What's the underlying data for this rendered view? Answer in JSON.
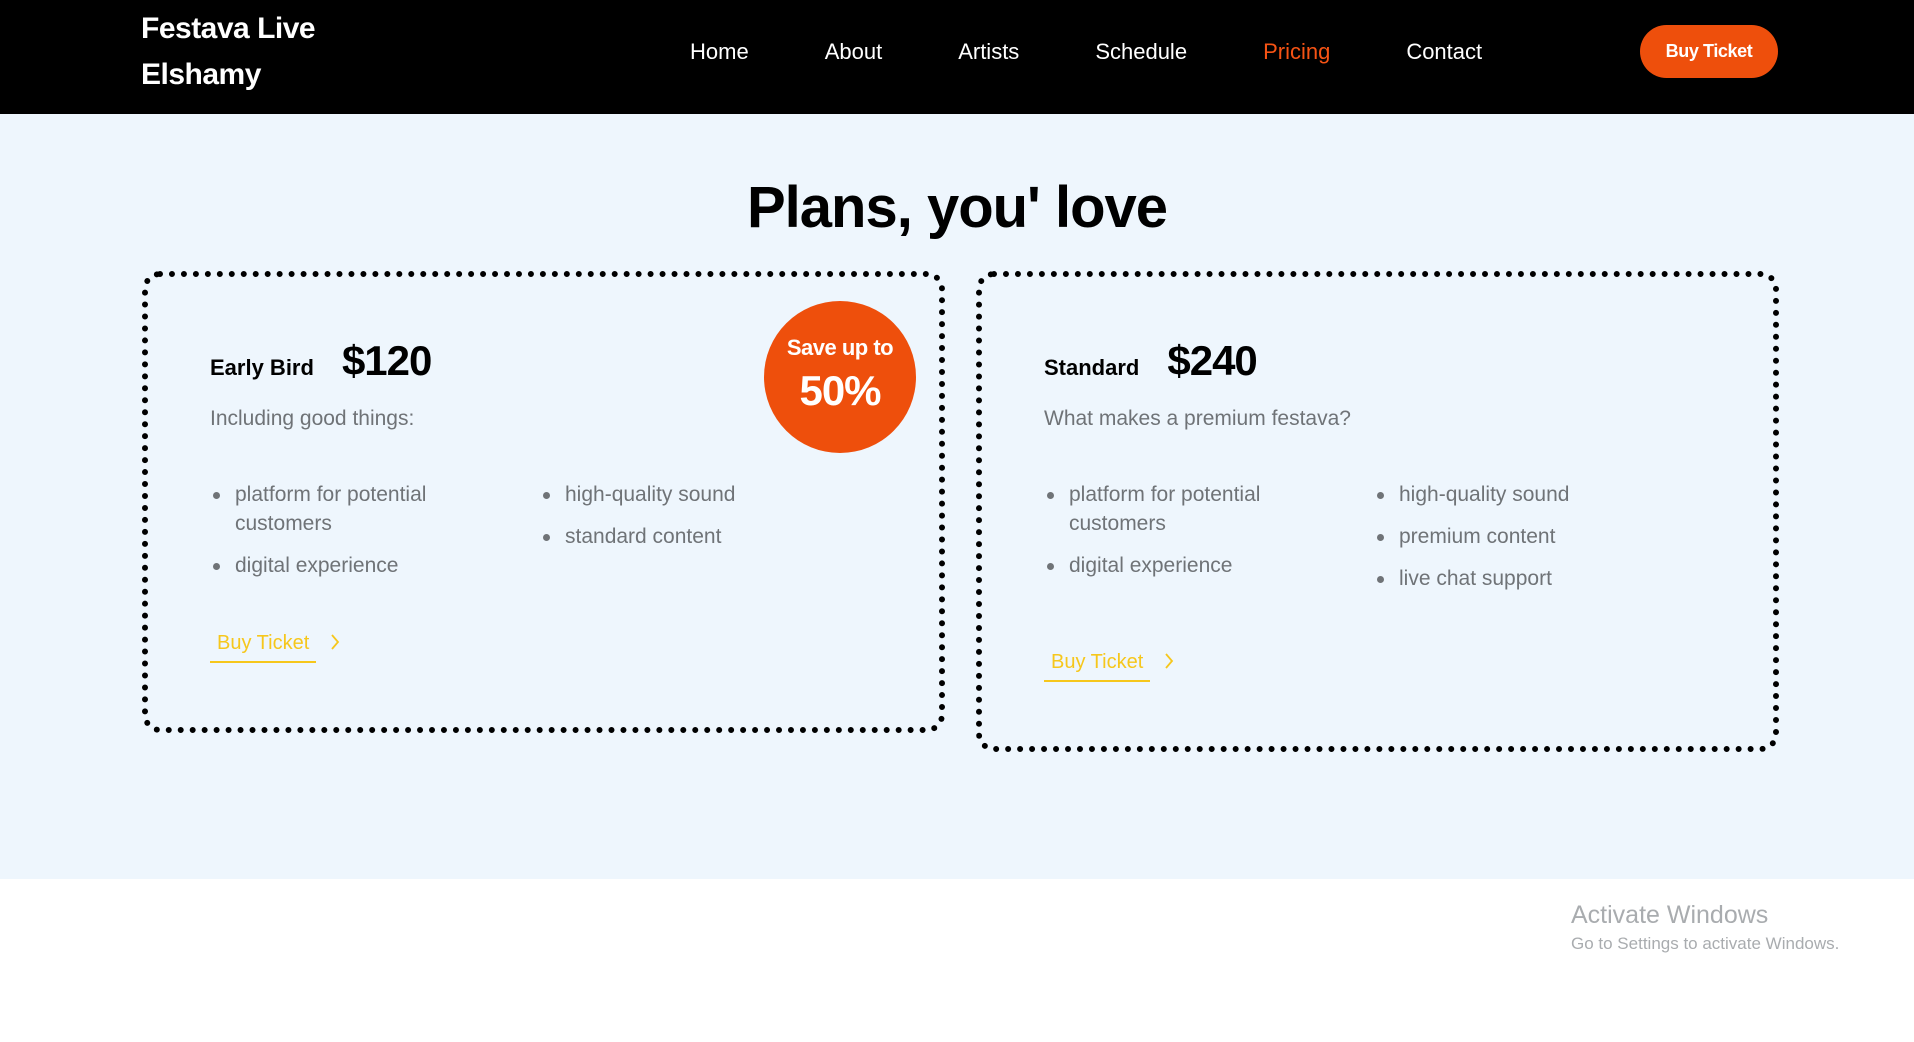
{
  "nav": {
    "brand_line1": "Festava Live",
    "brand_line2": "Elshamy",
    "links": [
      {
        "label": "Home"
      },
      {
        "label": "About"
      },
      {
        "label": "Artists"
      },
      {
        "label": "Schedule"
      },
      {
        "label": "Pricing",
        "active": true
      },
      {
        "label": "Contact"
      }
    ],
    "cta_label": "Buy Ticket"
  },
  "pricing": {
    "title": "Plans, you' love",
    "plans": [
      {
        "name": "Early Bird",
        "price": "$120",
        "subtitle": "Including good things:",
        "features_left": [
          "platform for potential customers",
          "digital experience"
        ],
        "features_right": [
          "high-quality sound",
          "standard content"
        ],
        "cta_label": "Buy Ticket",
        "badge": {
          "line1": "Save up to",
          "line2": "50%"
        }
      },
      {
        "name": "Standard",
        "price": "$240",
        "subtitle": "What makes a premium festava?",
        "features_left": [
          "platform for potential customers",
          "digital experience"
        ],
        "features_right": [
          "high-quality sound",
          "premium content",
          "live chat support"
        ],
        "cta_label": "Buy Ticket"
      }
    ]
  },
  "watermark": {
    "title": "Activate Windows",
    "subtitle": "Go to Settings to activate Windows."
  },
  "colors": {
    "accent": "#ee4f0c",
    "nav_active": "#f65314",
    "link_yellow": "#f6c71c",
    "section_bg": "#eef6fd",
    "navbar_bg": "#000000"
  },
  "icons": {
    "buy_link_arrow": "chevron-right-icon",
    "feature_bullet": "bullet-dot-icon"
  }
}
